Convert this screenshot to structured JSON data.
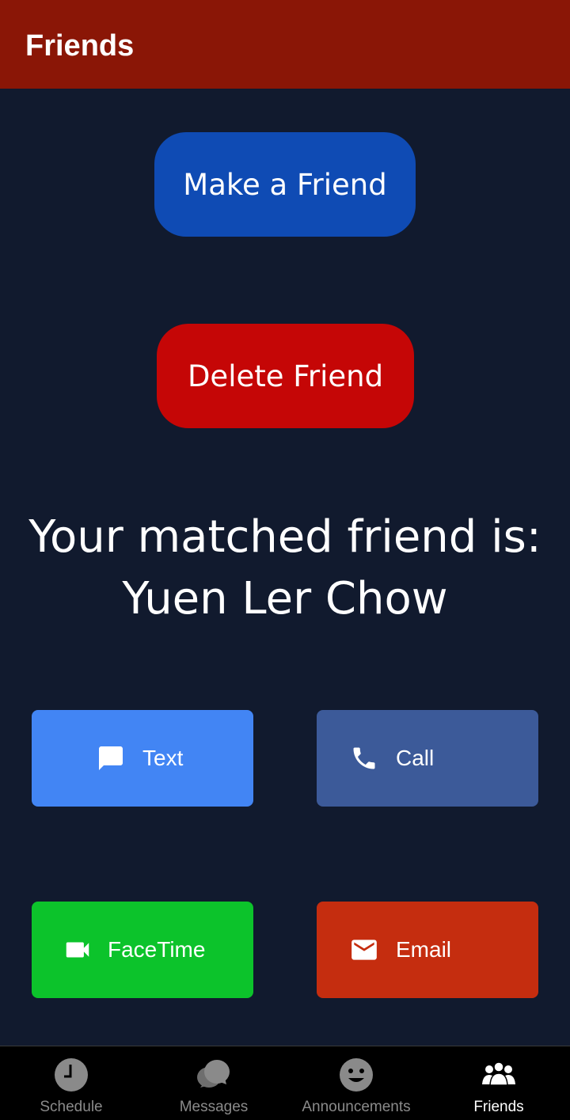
{
  "header": {
    "title": "Friends"
  },
  "actions": {
    "make_friend_label": "Make a Friend",
    "delete_friend_label": "Delete Friend"
  },
  "match": {
    "prefix": "Your matched friend is:",
    "friend_name": "Yuen Ler Chow"
  },
  "contact_buttons": [
    {
      "label": "Text",
      "icon": "message-icon",
      "color": "#4285f4"
    },
    {
      "label": "Call",
      "icon": "phone-icon",
      "color": "#3c5a99"
    },
    {
      "label": "FaceTime",
      "icon": "video-camera-icon",
      "color": "#0cc32b"
    },
    {
      "label": "Email",
      "icon": "mail-icon",
      "color": "#c52d0f"
    }
  ],
  "tabs": [
    {
      "label": "Schedule",
      "icon": "clock-icon",
      "active": false
    },
    {
      "label": "Messages",
      "icon": "chat-bubbles-icon",
      "active": false
    },
    {
      "label": "Announcements",
      "icon": "smiley-icon",
      "active": false
    },
    {
      "label": "Friends",
      "icon": "people-icon",
      "active": true
    }
  ],
  "colors": {
    "header_bg": "#8a1606",
    "page_bg": "#111a2e",
    "make_button": "#0f4bb4",
    "delete_button": "#c50606",
    "tabbar_bg": "#000000"
  }
}
